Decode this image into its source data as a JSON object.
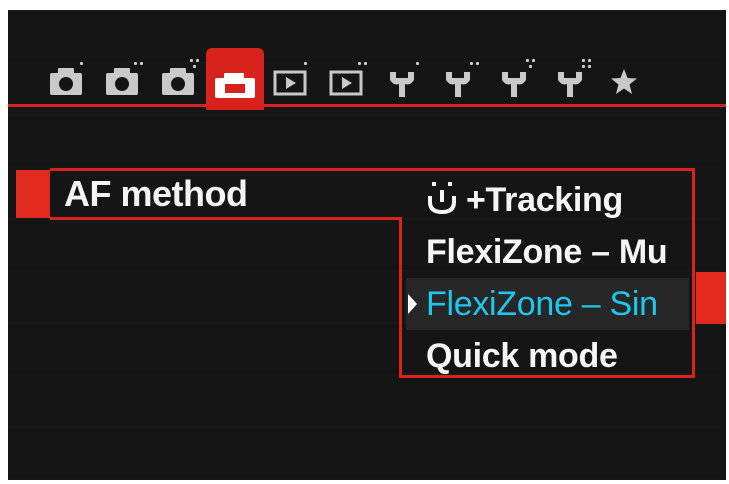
{
  "tabs": [
    {
      "icon": "camera-icon",
      "dots": 1,
      "active": false
    },
    {
      "icon": "camera-icon",
      "dots": 2,
      "active": false
    },
    {
      "icon": "camera-icon",
      "dots": 3,
      "active": false
    },
    {
      "icon": "camera-icon",
      "dots": 4,
      "active": true
    },
    {
      "icon": "playback-icon",
      "dots": 1,
      "active": false
    },
    {
      "icon": "playback-icon",
      "dots": 2,
      "active": false
    },
    {
      "icon": "wrench-icon",
      "dots": 1,
      "active": false
    },
    {
      "icon": "wrench-icon",
      "dots": 2,
      "active": false
    },
    {
      "icon": "wrench-icon",
      "dots": 3,
      "active": false
    },
    {
      "icon": "wrench-icon",
      "dots": 4,
      "active": false
    },
    {
      "icon": "star-icon",
      "dots": 0,
      "active": false
    }
  ],
  "menu": {
    "label": "AF method",
    "options": [
      {
        "icon": "face-detect-icon",
        "label": "+Tracking",
        "selected": false
      },
      {
        "label": "FlexiZone – Mu",
        "selected": false
      },
      {
        "label": "FlexiZone – Sin",
        "selected": true
      },
      {
        "label": "Quick mode",
        "selected": false
      }
    ]
  },
  "colors": {
    "accent": "#d8221c",
    "background": "#151515",
    "text": "#f4f4f4",
    "selected_text": "#1cc8ee"
  }
}
